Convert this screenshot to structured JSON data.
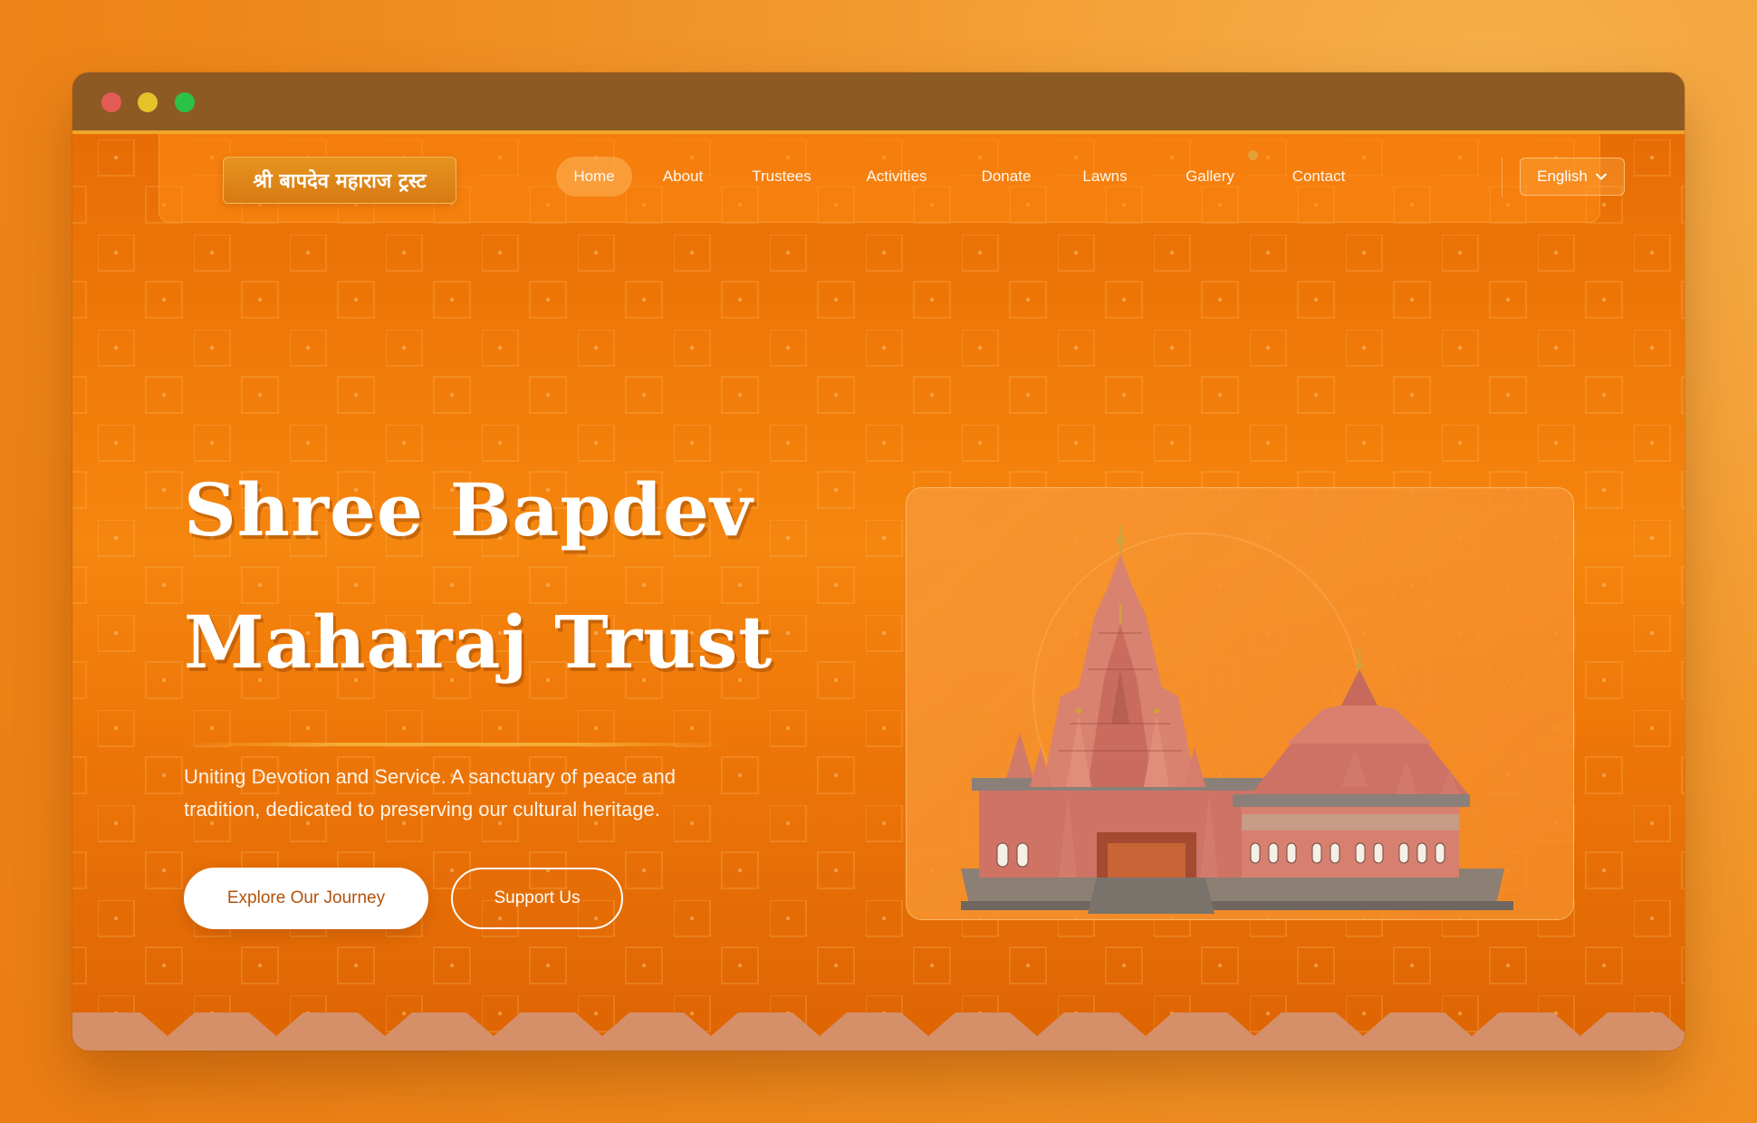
{
  "window": {
    "buttons": [
      "close",
      "minimize",
      "maximize"
    ]
  },
  "nav": {
    "logo": "श्री बापदेव महाराज ट्रस्ट",
    "links": [
      {
        "label": "Home",
        "active": true
      },
      {
        "label": "About",
        "active": false
      },
      {
        "label": "Trustees",
        "active": false
      },
      {
        "label": "Activities",
        "active": false
      },
      {
        "label": "Donate",
        "active": false
      },
      {
        "label": "Lawns",
        "active": false
      },
      {
        "label": "Gallery",
        "active": false
      },
      {
        "label": "Contact",
        "active": false
      }
    ],
    "language": "English"
  },
  "hero": {
    "title_line1": "Shree Bapdev",
    "title_line2": "Maharaj Trust",
    "subtitle_line1": "Uniting Devotion and Service. A sanctuary of peace and",
    "subtitle_line2": "tradition, dedicated to preserving our cultural heritage.",
    "primary_button": "Explore Our Journey",
    "secondary_button": "Support Us"
  },
  "colors": {
    "accent": "#f07a08",
    "button_text": "#b2520b",
    "titlebar": "#8d5a24"
  }
}
